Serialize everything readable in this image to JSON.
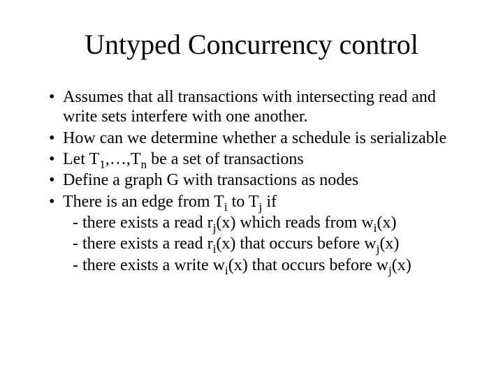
{
  "title": "Untyped Concurrency control",
  "bullets": {
    "b1": "Assumes that all transactions with intersecting read and write sets interfere with one another.",
    "b2": "How can we determine whether a schedule is serializable",
    "b3": {
      "pre": "Let T",
      "mid": ",…,T",
      "post": " be a set of transactions",
      "s1": "1",
      "s2": "n"
    },
    "b4": "Define a graph G with transactions as nodes",
    "b5": {
      "pre": "There is an edge from T",
      "mid": " to T",
      "post": " if",
      "s1": "i",
      "s2": "j"
    }
  },
  "subs": {
    "s1": {
      "a": "- there exists a read r",
      "b": "(x) which reads from w",
      "c": "(x)",
      "i1": "j",
      "i2": "i"
    },
    "s2": {
      "a": "- there exists a read r",
      "b": "(x) that occurs before w",
      "c": "(x)",
      "i1": "i",
      "i2": "j"
    },
    "s3": {
      "a": "- there exists a write w",
      "b": "(x) that occurs before w",
      "c": "(x)",
      "i1": "i",
      "i2": "j"
    }
  }
}
